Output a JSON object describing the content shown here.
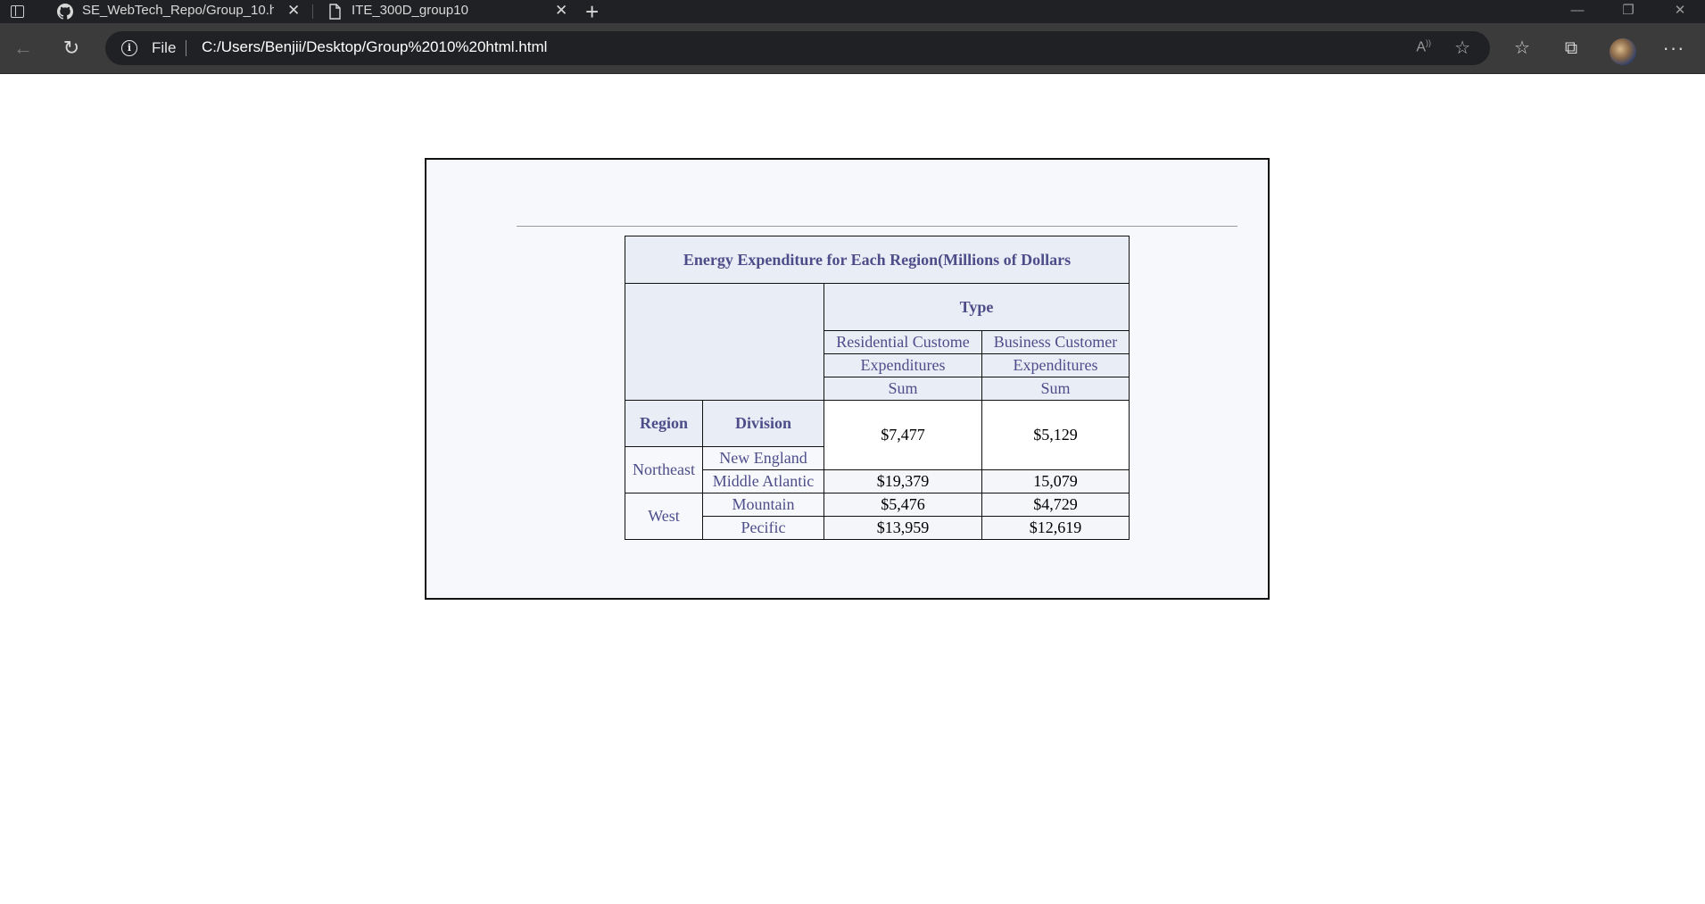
{
  "browser": {
    "tabs": [
      {
        "title": "SE_WebTech_Repo/Group_10.html",
        "active": false
      },
      {
        "title": "ITE_300D_group10",
        "active": true
      }
    ],
    "address": {
      "scheme_label": "File",
      "url": "C:/Users/Benjii/Desktop/Group%2010%20html.html"
    },
    "colors": {
      "tabstrip": "#202124",
      "toolbar": "#3b3b3b"
    }
  },
  "report": {
    "caption": "Energy Expenditure for Each Region(Millions of Dollars",
    "type_header": "Type",
    "columns": [
      {
        "label": "Residential Custome",
        "measure": "Expenditures",
        "stat": "Sum"
      },
      {
        "label": "Business Customer",
        "measure": "Expenditures",
        "stat": "Sum"
      }
    ],
    "row_headers": {
      "region": "Region",
      "division": "Division"
    },
    "regions": [
      {
        "name": "Northeast",
        "divisions": [
          {
            "name": "New England",
            "residential": "$7,477",
            "business": "$5,129"
          },
          {
            "name": "Middle Atlantic",
            "residential": "$19,379",
            "business": "15,079"
          }
        ]
      },
      {
        "name": "West",
        "divisions": [
          {
            "name": "Mountain",
            "residential": "$5,476",
            "business": "$4,729"
          },
          {
            "name": "Pecific",
            "residential": "$13,959",
            "business": "$12,619"
          }
        ]
      }
    ],
    "colors": {
      "header_bg": "#e9eef6",
      "header_text": "#4d4d8a",
      "page_bg": "#f7f8fc"
    }
  }
}
